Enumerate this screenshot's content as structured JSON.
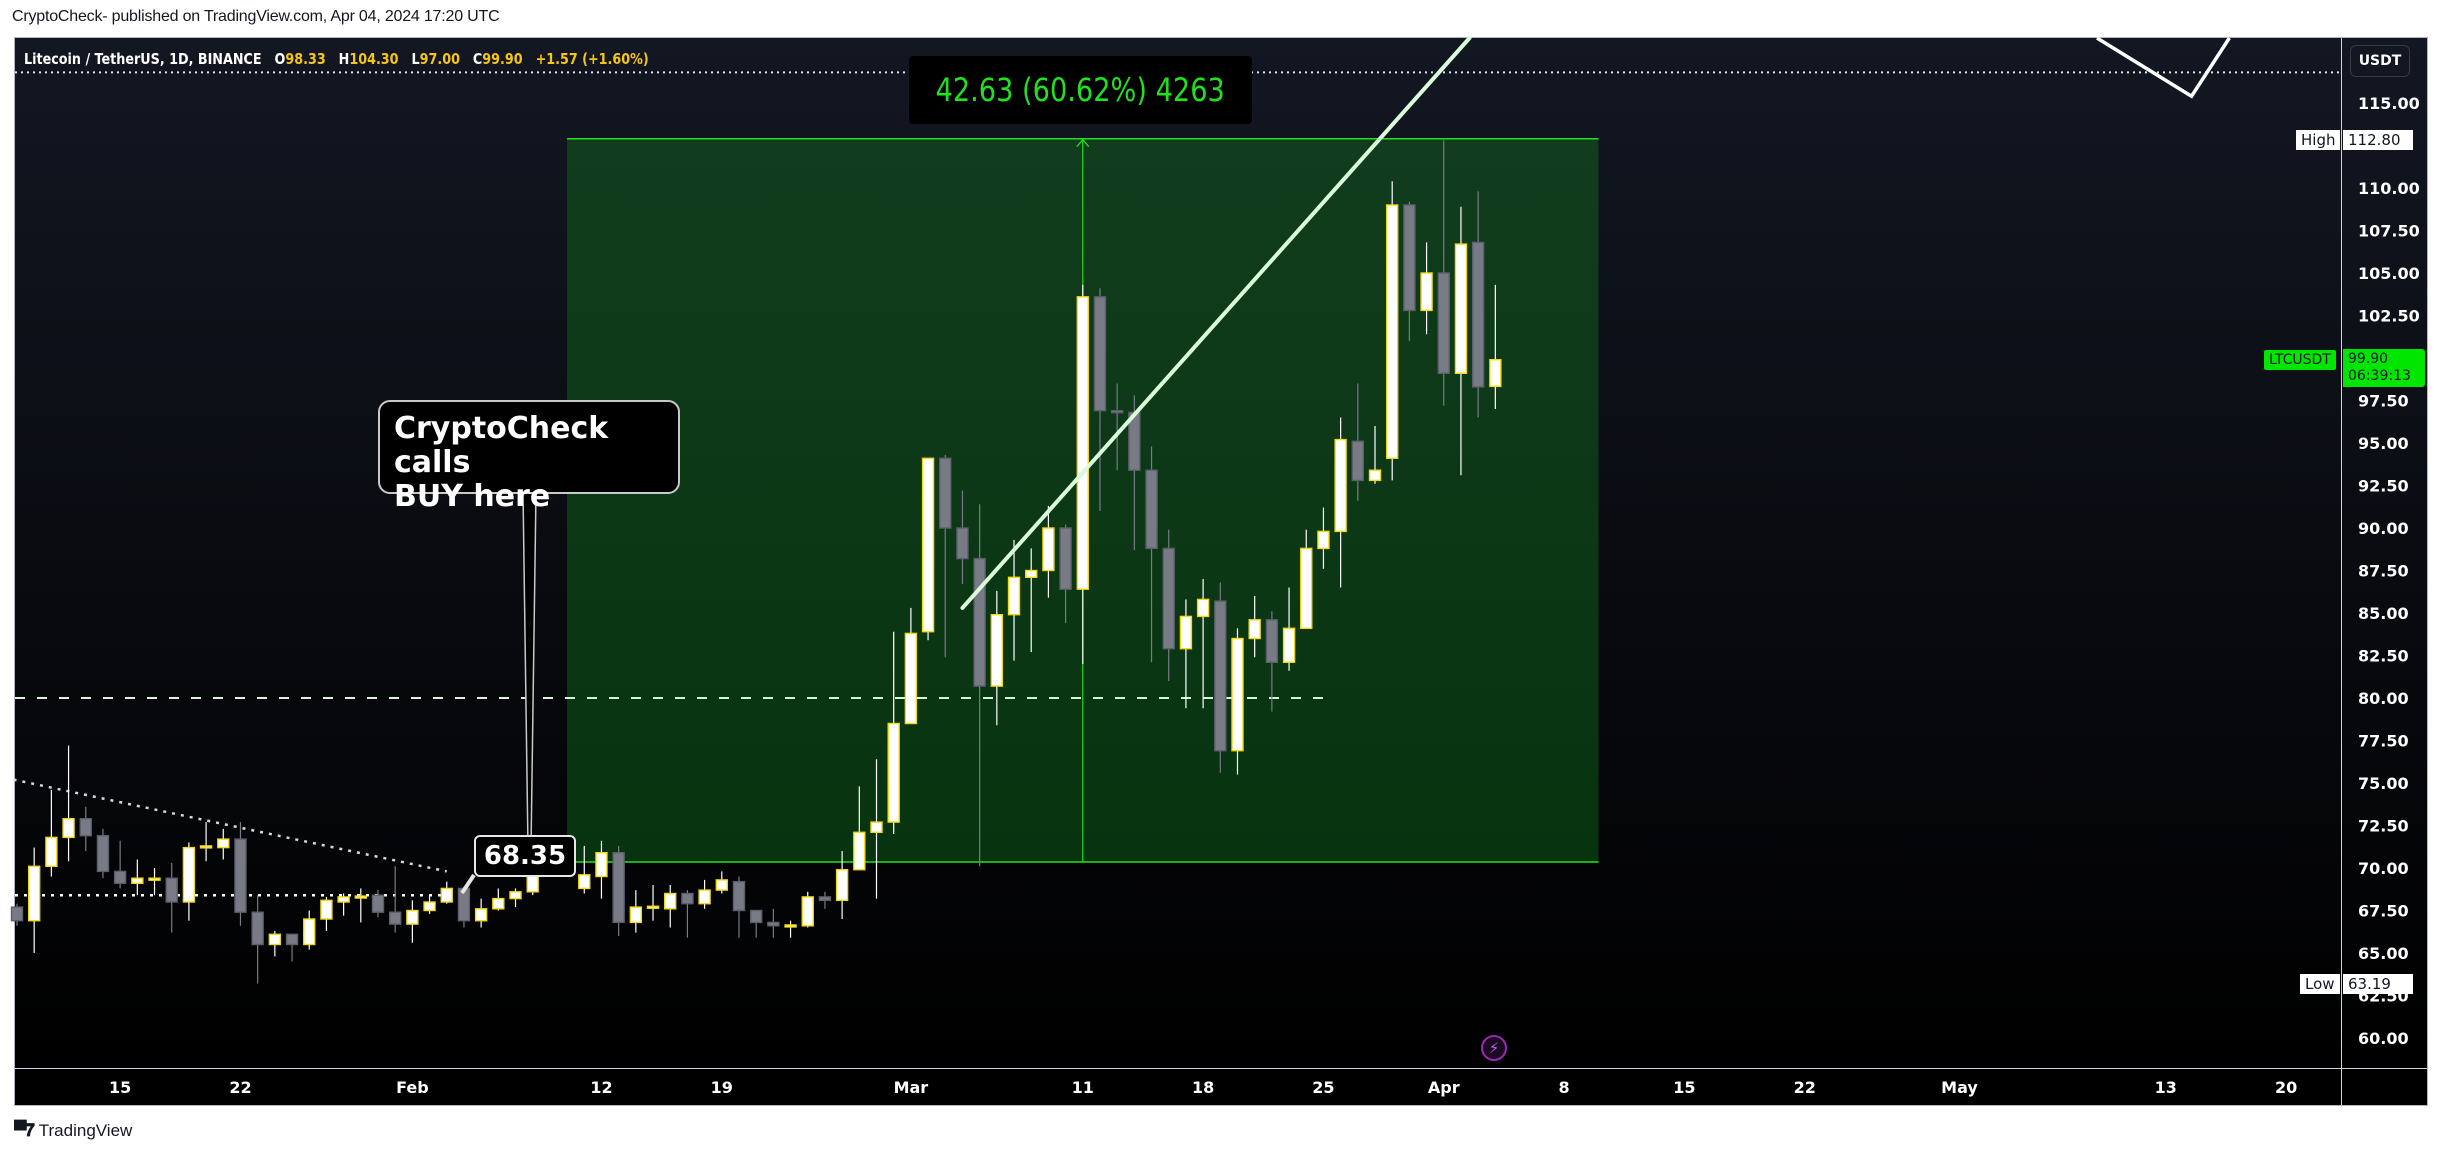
{
  "header": {
    "published": "CryptoCheck- published on TradingView.com, Apr 04, 2024 17:20 UTC"
  },
  "legend": {
    "symbol": "Litecoin / TetherUS, 1D, BINANCE",
    "open_label": "O",
    "open": "98.33",
    "high_label": "H",
    "high": "104.30",
    "low_label": "L",
    "low": "97.00",
    "close_label": "C",
    "close": "99.90",
    "change": "+1.57 (+1.60%)"
  },
  "price_axis": {
    "currency_button": "USDT",
    "high_tag_label": "High",
    "high_tag_value": "112.80",
    "low_tag_label": "Low",
    "low_tag_value": "63.19",
    "last_symbol": "LTCUSDT",
    "last_price": "99.90",
    "countdown": "06:39:13"
  },
  "annotations": {
    "measure_text": "42.63 (60.62%) 4263",
    "callout_line1": "CryptoCheck calls",
    "callout_line2": "BUY here",
    "entry_price_label": "68.35"
  },
  "footer": {
    "brand": "TradingView"
  },
  "colors": {
    "bull_body": "#ffffff",
    "bull_border": "#f5d90a",
    "bear_body": "#787b86",
    "bear_border": "#5d606b",
    "measure_green": "#22e01e",
    "zone_fill": "#0b3a17",
    "last_price_bg": "#00e600"
  },
  "chart_data": {
    "type": "candlestick",
    "title": "Litecoin / TetherUS, 1D, BINANCE",
    "xlabel": "",
    "ylabel": "USDT",
    "ylim": [
      58.0,
      118.0
    ],
    "y_ticks": [
      "60.00",
      "62.50",
      "65.00",
      "67.50",
      "70.00",
      "72.50",
      "75.00",
      "77.50",
      "80.00",
      "82.50",
      "85.00",
      "87.50",
      "90.00",
      "92.50",
      "95.00",
      "97.50",
      "100.00",
      "102.50",
      "105.00",
      "107.50",
      "110.00",
      "115.00"
    ],
    "y_tick_values": [
      60,
      62.5,
      65,
      67.5,
      70,
      72.5,
      75,
      77.5,
      80,
      82.5,
      85,
      87.5,
      90,
      92.5,
      95,
      97.5,
      100,
      102.5,
      105,
      107.5,
      110,
      115
    ],
    "x_ticks": [
      {
        "label": "15",
        "day": 6
      },
      {
        "label": "22",
        "day": 13
      },
      {
        "label": "Feb",
        "day": 23
      },
      {
        "label": "12",
        "day": 34
      },
      {
        "label": "19",
        "day": 41
      },
      {
        "label": "Mar",
        "day": 52
      },
      {
        "label": "11",
        "day": 62
      },
      {
        "label": "18",
        "day": 69
      },
      {
        "label": "25",
        "day": 76
      },
      {
        "label": "Apr",
        "day": 83
      },
      {
        "label": "8",
        "day": 90
      },
      {
        "label": "15",
        "day": 97
      },
      {
        "label": "22",
        "day": 104
      },
      {
        "label": "May",
        "day": 113
      },
      {
        "label": "13",
        "day": 125
      },
      {
        "label": "20",
        "day": 132
      }
    ],
    "x_range_days": [
      -0.2,
      136.5
    ],
    "start_date": "2024-01-09",
    "grid": false,
    "candles": [
      [
        67.7,
        67.9,
        66.6,
        66.9
      ],
      [
        66.9,
        71.2,
        65.0,
        70.1
      ],
      [
        70.1,
        74.6,
        69.5,
        71.8
      ],
      [
        71.8,
        77.2,
        70.4,
        72.9
      ],
      [
        72.9,
        73.6,
        71.0,
        71.9
      ],
      [
        71.9,
        72.3,
        69.4,
        69.8
      ],
      [
        69.8,
        71.6,
        68.8,
        69.1
      ],
      [
        69.1,
        70.5,
        68.4,
        69.4
      ],
      [
        69.4,
        70.0,
        68.4,
        69.4
      ],
      [
        69.4,
        70.3,
        66.2,
        68.0
      ],
      [
        68.0,
        71.5,
        66.9,
        71.2
      ],
      [
        71.2,
        72.7,
        70.4,
        71.3
      ],
      [
        71.2,
        72.3,
        70.5,
        71.7
      ],
      [
        71.7,
        72.7,
        66.6,
        67.4
      ],
      [
        67.4,
        68.4,
        63.2,
        65.5
      ],
      [
        65.5,
        66.3,
        64.8,
        66.1
      ],
      [
        66.1,
        66.1,
        64.5,
        65.5
      ],
      [
        65.5,
        67.5,
        65.2,
        67.0
      ],
      [
        67.0,
        68.3,
        66.3,
        68.1
      ],
      [
        68.0,
        68.5,
        67.2,
        68.3
      ],
      [
        68.35,
        68.8,
        66.8,
        68.35
      ],
      [
        68.4,
        68.7,
        67.1,
        67.4
      ],
      [
        67.4,
        70.1,
        66.2,
        66.7
      ],
      [
        66.7,
        68.1,
        65.6,
        67.5
      ],
      [
        67.5,
        68.4,
        67.3,
        68.0
      ],
      [
        68.0,
        69.2,
        67.9,
        68.8
      ],
      [
        68.8,
        68.9,
        66.5,
        66.9
      ],
      [
        66.9,
        68.2,
        66.5,
        67.6
      ],
      [
        67.6,
        68.8,
        67.5,
        68.2
      ],
      [
        68.2,
        68.8,
        67.7,
        68.6
      ],
      [
        68.6,
        70.6,
        68.4,
        70.5
      ],
      [
        70.5,
        71.8,
        70.1,
        70.55
      ],
      [
        70.5,
        71.3,
        69.9,
        70.7
      ],
      [
        68.8,
        71.3,
        68.5,
        69.6
      ],
      [
        69.5,
        71.6,
        68.2,
        70.9
      ],
      [
        70.9,
        71.3,
        66.0,
        66.8
      ],
      [
        66.8,
        68.7,
        66.2,
        67.7
      ],
      [
        67.7,
        69.0,
        66.9,
        67.75
      ],
      [
        67.6,
        69.0,
        66.5,
        68.5
      ],
      [
        68.5,
        68.7,
        65.9,
        67.9
      ],
      [
        67.9,
        69.3,
        67.6,
        68.7
      ],
      [
        68.7,
        69.8,
        68.5,
        69.3
      ],
      [
        69.2,
        69.5,
        65.9,
        67.5
      ],
      [
        67.5,
        67.5,
        65.9,
        66.8
      ],
      [
        66.8,
        67.6,
        65.9,
        66.6
      ],
      [
        66.6,
        66.9,
        65.9,
        66.65
      ],
      [
        66.6,
        68.6,
        66.5,
        68.3
      ],
      [
        68.3,
        68.6,
        67.6,
        68.1
      ],
      [
        68.1,
        71.0,
        67.0,
        69.9
      ],
      [
        69.9,
        74.8,
        69.9,
        72.1
      ],
      [
        72.1,
        76.4,
        68.2,
        72.7
      ],
      [
        72.7,
        83.9,
        72.0,
        78.5
      ],
      [
        78.5,
        85.3,
        78.5,
        83.8
      ],
      [
        83.9,
        94.1,
        83.4,
        94.1
      ],
      [
        94.1,
        94.3,
        82.4,
        90.0
      ],
      [
        90.0,
        92.2,
        86.7,
        88.2
      ],
      [
        88.2,
        91.4,
        70.1,
        80.7
      ],
      [
        80.7,
        86.3,
        78.4,
        84.9
      ],
      [
        84.9,
        89.3,
        82.2,
        87.1
      ],
      [
        87.1,
        88.8,
        82.7,
        87.5
      ],
      [
        87.5,
        91.3,
        85.9,
        90.0
      ],
      [
        90.0,
        90.2,
        84.4,
        86.4
      ],
      [
        86.4,
        104.3,
        82.0,
        103.6
      ],
      [
        103.6,
        104.1,
        91.0,
        96.9
      ],
      [
        96.9,
        98.5,
        93.4,
        96.8
      ],
      [
        96.8,
        97.8,
        88.7,
        93.4
      ],
      [
        93.4,
        94.8,
        82.1,
        88.8
      ],
      [
        88.8,
        89.9,
        81.0,
        82.9
      ],
      [
        82.9,
        85.8,
        79.4,
        84.8
      ],
      [
        84.8,
        87.0,
        79.4,
        85.8
      ],
      [
        85.7,
        86.8,
        75.6,
        76.9
      ],
      [
        76.9,
        84.1,
        75.5,
        83.5
      ],
      [
        83.5,
        86.0,
        82.4,
        84.6
      ],
      [
        84.6,
        85.1,
        79.2,
        82.1
      ],
      [
        82.1,
        86.5,
        81.6,
        84.1
      ],
      [
        84.1,
        89.9,
        84.1,
        88.8
      ],
      [
        88.8,
        91.2,
        87.6,
        89.8
      ],
      [
        89.8,
        96.5,
        86.5,
        95.2
      ],
      [
        95.1,
        98.5,
        91.6,
        92.8
      ],
      [
        92.8,
        96.0,
        92.6,
        93.4
      ],
      [
        94.1,
        110.4,
        92.8,
        109.0
      ],
      [
        109.0,
        109.2,
        101.0,
        102.8
      ],
      [
        102.8,
        106.8,
        101.4,
        105.0
      ],
      [
        105.0,
        112.8,
        97.2,
        99.1
      ],
      [
        99.1,
        108.9,
        93.1,
        106.7
      ],
      [
        106.8,
        109.8,
        96.5,
        98.3
      ],
      [
        98.33,
        104.3,
        97.0,
        99.9
      ]
    ],
    "candle_format": [
      "open",
      "high",
      "low",
      "close"
    ],
    "overlays": {
      "measure_zone": {
        "from_day": 32,
        "to_day": 92,
        "low": 70.35,
        "high": 112.9,
        "arrow_day": 62
      },
      "entry_dashed_level": {
        "price": 80.0,
        "to_day": 76
      },
      "support_dotted_level": {
        "price": 68.4,
        "to_day": 25
      },
      "resistance_dotted_level": {
        "price": 116.8
      },
      "descending_dotted_trendline": {
        "from": [
          -0.2,
          75.2
        ],
        "to": [
          25.0,
          69.8
        ]
      },
      "rising_trendline": {
        "from": [
          55.0,
          85.3
        ],
        "to": [
          84.5,
          119.0
        ]
      },
      "zigzag_line": [
        [
          121.0,
          119.0
        ],
        [
          126.5,
          115.4
        ],
        [
          128.7,
          119.0
        ]
      ]
    }
  }
}
